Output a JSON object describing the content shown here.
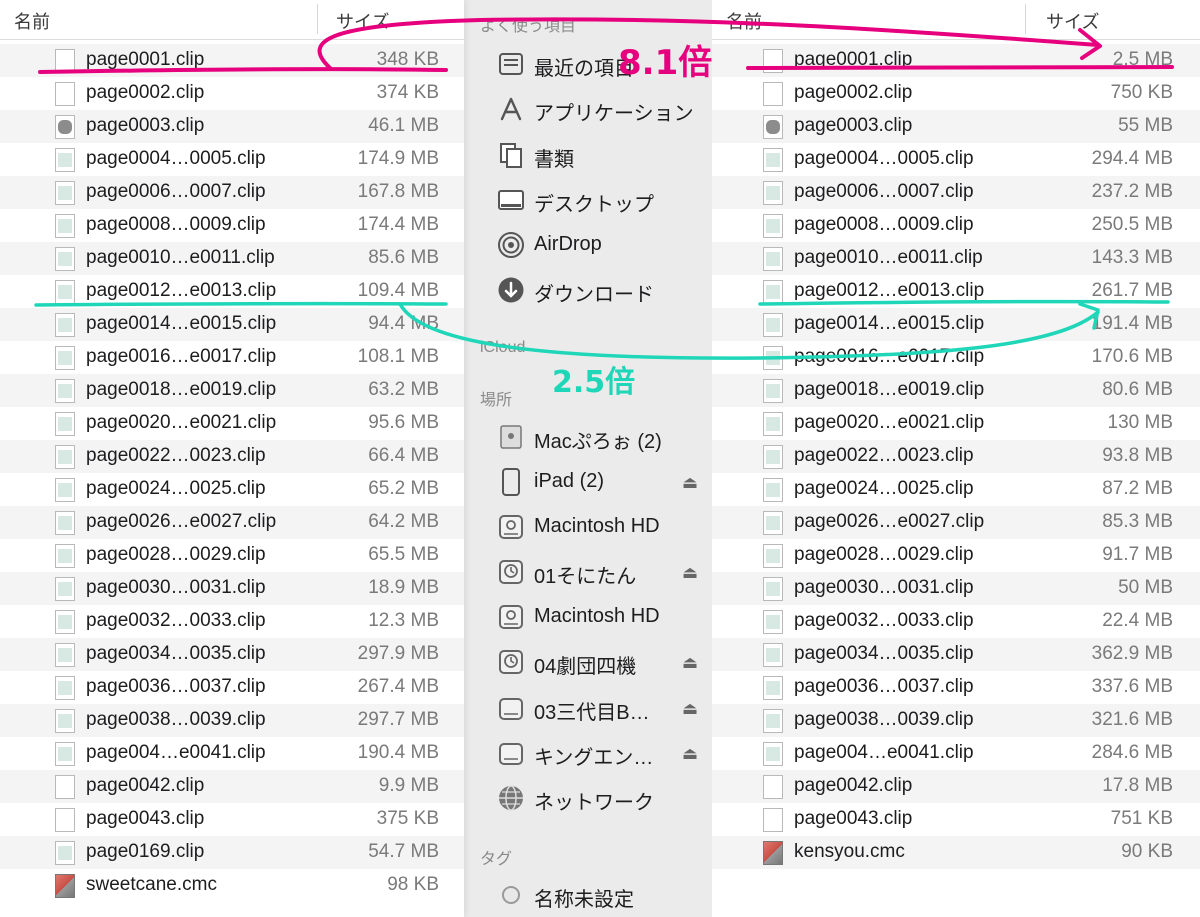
{
  "left_pane": {
    "header": {
      "name": "名前",
      "size": "サイズ"
    },
    "files": [
      {
        "name": "page0001.clip",
        "size": "348 KB",
        "icon": "blank"
      },
      {
        "name": "page0002.clip",
        "size": "374 KB",
        "icon": "blank"
      },
      {
        "name": "page0003.clip",
        "size": "46.1 MB",
        "icon": "gray"
      },
      {
        "name": "page0004…0005.clip",
        "size": "174.9 MB",
        "icon": "thumb"
      },
      {
        "name": "page0006…0007.clip",
        "size": "167.8 MB",
        "icon": "thumb"
      },
      {
        "name": "page0008…0009.clip",
        "size": "174.4 MB",
        "icon": "thumb"
      },
      {
        "name": "page0010…e0011.clip",
        "size": "85.6 MB",
        "icon": "thumb"
      },
      {
        "name": "page0012…e0013.clip",
        "size": "109.4 MB",
        "icon": "thumb"
      },
      {
        "name": "page0014…e0015.clip",
        "size": "94.4 MB",
        "icon": "thumb"
      },
      {
        "name": "page0016…e0017.clip",
        "size": "108.1 MB",
        "icon": "thumb"
      },
      {
        "name": "page0018…e0019.clip",
        "size": "63.2 MB",
        "icon": "thumb"
      },
      {
        "name": "page0020…e0021.clip",
        "size": "95.6 MB",
        "icon": "thumb"
      },
      {
        "name": "page0022…0023.clip",
        "size": "66.4 MB",
        "icon": "thumb"
      },
      {
        "name": "page0024…0025.clip",
        "size": "65.2 MB",
        "icon": "thumb"
      },
      {
        "name": "page0026…e0027.clip",
        "size": "64.2 MB",
        "icon": "thumb"
      },
      {
        "name": "page0028…0029.clip",
        "size": "65.5 MB",
        "icon": "thumb"
      },
      {
        "name": "page0030…0031.clip",
        "size": "18.9 MB",
        "icon": "thumb"
      },
      {
        "name": "page0032…0033.clip",
        "size": "12.3 MB",
        "icon": "thumb"
      },
      {
        "name": "page0034…0035.clip",
        "size": "297.9 MB",
        "icon": "thumb"
      },
      {
        "name": "page0036…0037.clip",
        "size": "267.4 MB",
        "icon": "thumb"
      },
      {
        "name": "page0038…0039.clip",
        "size": "297.7 MB",
        "icon": "thumb"
      },
      {
        "name": "page004…e0041.clip",
        "size": "190.4 MB",
        "icon": "thumb"
      },
      {
        "name": "page0042.clip",
        "size": "9.9 MB",
        "icon": "blank"
      },
      {
        "name": "page0043.clip",
        "size": "375 KB",
        "icon": "blank"
      },
      {
        "name": "page0169.clip",
        "size": "54.7 MB",
        "icon": "thumb"
      },
      {
        "name": "sweetcane.cmc",
        "size": "98 KB",
        "icon": "app"
      }
    ]
  },
  "right_pane": {
    "header": {
      "name": "名前",
      "size": "サイズ"
    },
    "files": [
      {
        "name": "page0001.clip",
        "size": "2.5 MB",
        "icon": "blank"
      },
      {
        "name": "page0002.clip",
        "size": "750 KB",
        "icon": "blank"
      },
      {
        "name": "page0003.clip",
        "size": "55 MB",
        "icon": "gray"
      },
      {
        "name": "page0004…0005.clip",
        "size": "294.4 MB",
        "icon": "thumb"
      },
      {
        "name": "page0006…0007.clip",
        "size": "237.2 MB",
        "icon": "thumb"
      },
      {
        "name": "page0008…0009.clip",
        "size": "250.5 MB",
        "icon": "thumb"
      },
      {
        "name": "page0010…e0011.clip",
        "size": "143.3 MB",
        "icon": "thumb"
      },
      {
        "name": "page0012…e0013.clip",
        "size": "261.7 MB",
        "icon": "thumb"
      },
      {
        "name": "page0014…e0015.clip",
        "size": "191.4 MB",
        "icon": "thumb"
      },
      {
        "name": "page0016…e0017.clip",
        "size": "170.6 MB",
        "icon": "thumb"
      },
      {
        "name": "page0018…e0019.clip",
        "size": "80.6 MB",
        "icon": "thumb"
      },
      {
        "name": "page0020…e0021.clip",
        "size": "130 MB",
        "icon": "thumb"
      },
      {
        "name": "page0022…0023.clip",
        "size": "93.8 MB",
        "icon": "thumb"
      },
      {
        "name": "page0024…0025.clip",
        "size": "87.2 MB",
        "icon": "thumb"
      },
      {
        "name": "page0026…e0027.clip",
        "size": "85.3 MB",
        "icon": "thumb"
      },
      {
        "name": "page0028…0029.clip",
        "size": "91.7 MB",
        "icon": "thumb"
      },
      {
        "name": "page0030…0031.clip",
        "size": "50 MB",
        "icon": "thumb"
      },
      {
        "name": "page0032…0033.clip",
        "size": "22.4 MB",
        "icon": "thumb"
      },
      {
        "name": "page0034…0035.clip",
        "size": "362.9 MB",
        "icon": "thumb"
      },
      {
        "name": "page0036…0037.clip",
        "size": "337.6 MB",
        "icon": "thumb"
      },
      {
        "name": "page0038…0039.clip",
        "size": "321.6 MB",
        "icon": "thumb"
      },
      {
        "name": "page004…e0041.clip",
        "size": "284.6 MB",
        "icon": "thumb"
      },
      {
        "name": "page0042.clip",
        "size": "17.8 MB",
        "icon": "blank"
      },
      {
        "name": "page0043.clip",
        "size": "751 KB",
        "icon": "blank"
      },
      {
        "name": "kensyou.cmc",
        "size": "90 KB",
        "icon": "app"
      }
    ]
  },
  "sidebar": {
    "favorites_header": "よく使う項目",
    "favorites": [
      {
        "label": "最近の項目",
        "icon": "recents-icon"
      },
      {
        "label": "アプリケーション",
        "icon": "applications-icon"
      },
      {
        "label": "書類",
        "icon": "documents-icon"
      },
      {
        "label": "デスクトップ",
        "icon": "desktop-icon"
      },
      {
        "label": "AirDrop",
        "icon": "airdrop-icon"
      },
      {
        "label": "ダウンロード",
        "icon": "downloads-icon"
      }
    ],
    "icloud_header": "iCloud",
    "locations_header": "場所",
    "locations": [
      {
        "label": "Macぷろぉ (2)",
        "icon": "computer-icon",
        "eject": false
      },
      {
        "label": "iPad (2)",
        "icon": "ipad-icon",
        "eject": true
      },
      {
        "label": "Macintosh HD",
        "icon": "hard-drive-icon",
        "eject": false
      },
      {
        "label": "01そにたん",
        "icon": "time-machine-disk-icon",
        "eject": true
      },
      {
        "label": "Macintosh HD",
        "icon": "hard-drive-icon",
        "eject": false
      },
      {
        "label": "04劇団四機",
        "icon": "time-machine-disk-icon",
        "eject": true
      },
      {
        "label": "03三代目B…",
        "icon": "external-drive-icon",
        "eject": true
      },
      {
        "label": "キングエン…",
        "icon": "external-drive-icon",
        "eject": true
      },
      {
        "label": "ネットワーク",
        "icon": "network-icon",
        "eject": false
      }
    ],
    "tags_header": "タグ",
    "tags": [
      {
        "label": "名称未設定",
        "color": "#e8e8e8"
      }
    ]
  },
  "annotations": {
    "pink_note": "8.1倍",
    "teal_note": "2.5倍",
    "pink_color": "#e6007e",
    "teal_color": "#1fd6b8"
  }
}
